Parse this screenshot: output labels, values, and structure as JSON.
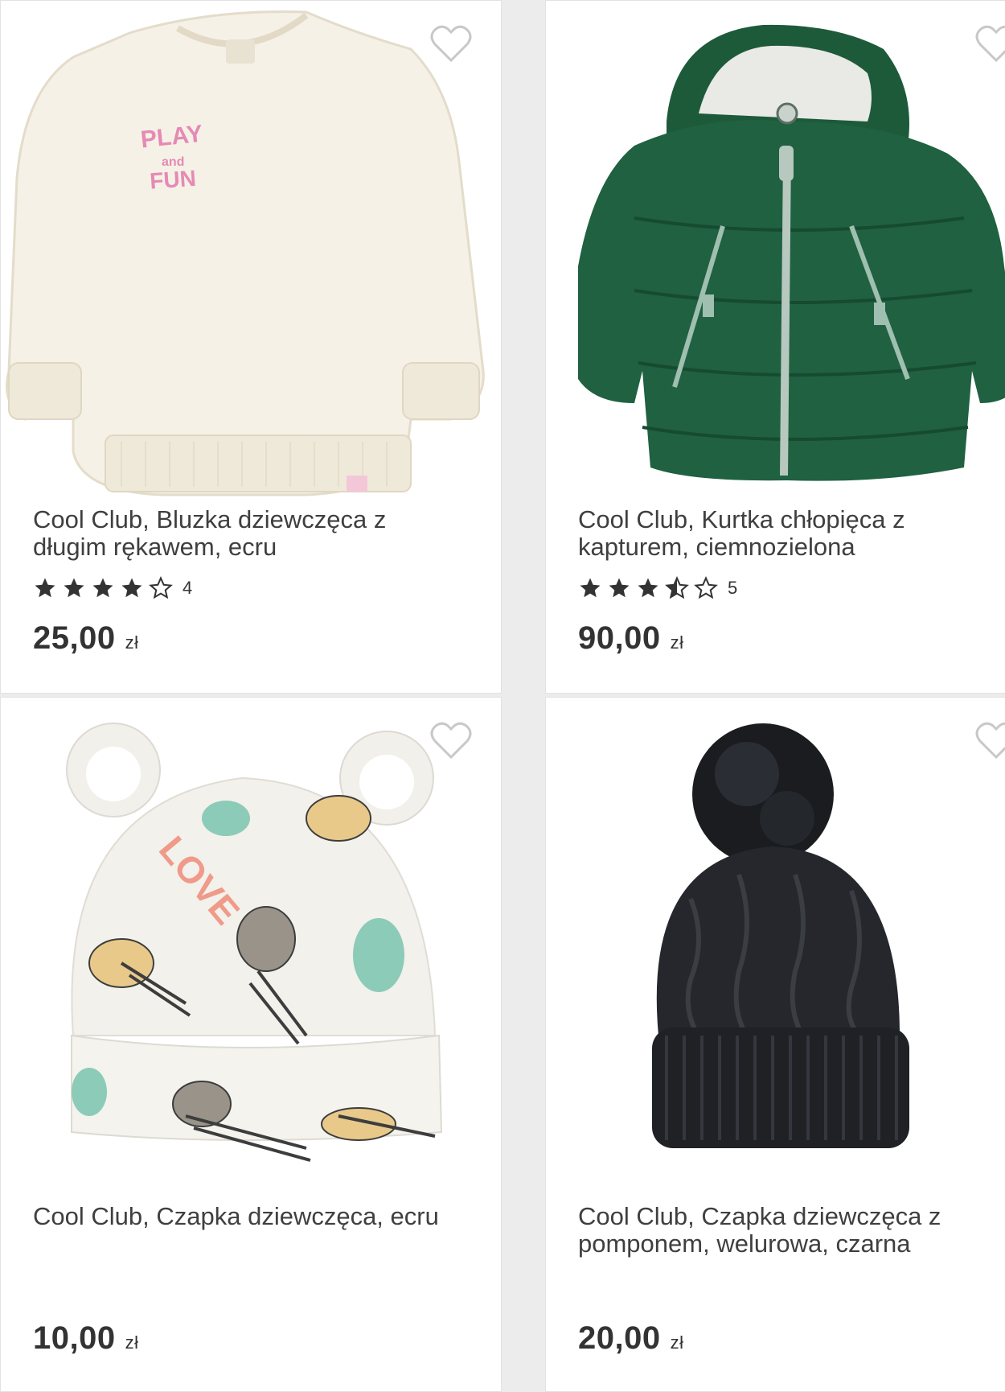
{
  "products": [
    {
      "title": "Cool Club, Bluzka dziewczęca z długim rękawem, ecru",
      "rating_count": "4",
      "stars": 4,
      "price": "25,00",
      "currency": "zł",
      "image_icon": "sweatshirt-icon",
      "print_text": "PLAY and FUN"
    },
    {
      "title": "Cool Club, Kurtka chłopięca z kapturem, ciemnozielona",
      "rating_count": "5",
      "stars": 3.5,
      "price": "90,00",
      "currency": "zł",
      "image_icon": "jacket-icon"
    },
    {
      "title": "Cool Club, Czapka dziewczęca, ecru",
      "price": "10,00",
      "currency": "zł",
      "image_icon": "hat-icon",
      "print_text": "LOVE"
    },
    {
      "title": "Cool Club, Czapka dziewczęca z pomponem, welurowa, czarna",
      "price": "20,00",
      "currency": "zł",
      "image_icon": "pompom-hat-icon"
    }
  ],
  "colors": {
    "background": "#ececec",
    "card": "#ffffff",
    "text": "#3f3f3f",
    "star": "#333333",
    "heart_outline": "#c8c8c8",
    "jacket_green": "#1d5a3a",
    "sweater_ecru": "#f5f1e6",
    "hat_black": "#222428"
  }
}
